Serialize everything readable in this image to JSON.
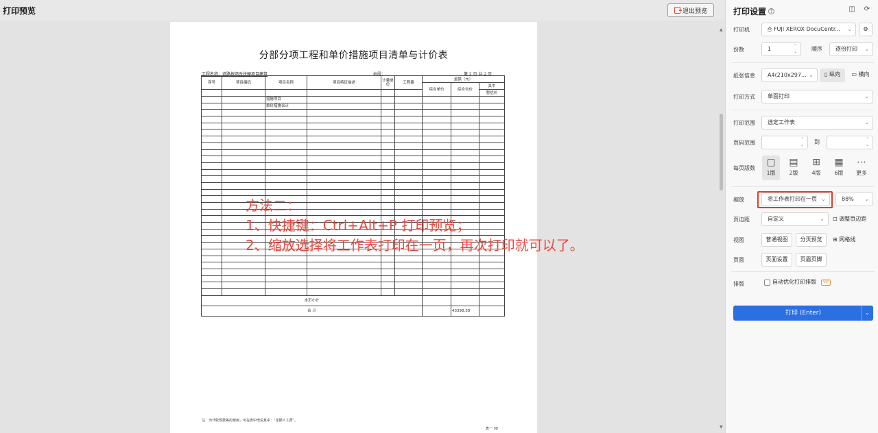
{
  "topbar": {
    "title": "打印预览",
    "exit_label": "退出预览"
  },
  "document": {
    "title": "分部分项工程和单价措施项目清单与计价表",
    "project_name": "工程名称：道路按墙改扶硬项目建筑",
    "section": "标段：",
    "page_info": "第 2 页  共 2 页",
    "headers": {
      "seq": "序号",
      "code": "项目编码",
      "name": "项目名称",
      "desc": "项目特征描述",
      "unit": "计量单位",
      "qty": "工程量",
      "amount": "金额（元）",
      "unit_price": "综合单价",
      "total_price": "综合合价",
      "of_which": "其中",
      "provisional": "暂估价"
    },
    "item_rows": [
      "措施项目",
      "单价措施合计"
    ],
    "page_subtotal": "本页小计",
    "grand_total": "合    计",
    "grand_total_value": "43398.38",
    "note": "注：为计取规费等的使用，可在表中增设其中：“定额人工费”。",
    "footer": "表一 08"
  },
  "annotation": {
    "line1": "方法二：",
    "line2": "1、快捷键：Ctrl+Alt+P 打印预览；",
    "line3": "2、缩放选择将工作表打印在一页，再次打印就可以了。"
  },
  "panel": {
    "title": "打印设置",
    "help_symbol": "?",
    "printer_label": "打印机",
    "printer_value": "FUJI XEROX DocuCentr...",
    "copies_label": "份数",
    "copies_value": "1",
    "order_label": "顺序",
    "order_value": "逐份打印",
    "paper_label": "纸张信息",
    "paper_value": "A4(210x297...",
    "portrait_label": "纵向",
    "landscape_label": "横向",
    "mode_label": "打印方式",
    "mode_value": "单面打印",
    "range_label": "打印范围",
    "range_value": "选定工作表",
    "page_range_label": "页码范围",
    "page_range_to": "到",
    "per_page_label": "每页版数",
    "per_page_options": [
      "1版",
      "2版",
      "4版",
      "6版",
      "更多"
    ],
    "zoom_label": "缩放",
    "zoom_value": "将工作表打印在一页",
    "zoom_percent": "88%",
    "margin_label": "页边距",
    "margin_value": "自定义",
    "adjust_margin_label": "调整页边距",
    "view_label": "视图",
    "normal_view": "普通视图",
    "page_break_view": "分页预览",
    "gridlines_label": "网格线",
    "page_label": "页面",
    "page_setup": "页面设置",
    "header_footer": "页眉页脚",
    "layout_label": "排版",
    "auto_optimize": "自动优化打印排版",
    "vip": "VIP",
    "print_button": "打印 (Enter)"
  }
}
